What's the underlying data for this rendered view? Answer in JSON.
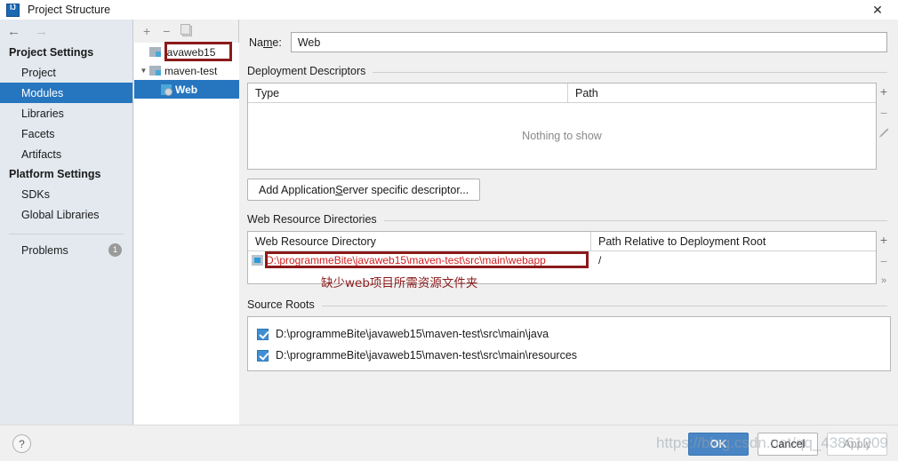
{
  "window": {
    "title": "Project Structure",
    "logo_text": "IJ",
    "close_icon": "✕"
  },
  "nav": {
    "back_icon": "←",
    "forward_icon": "→"
  },
  "sidebar": {
    "groups": [
      {
        "title": "Project Settings",
        "items": [
          {
            "label": "Project",
            "selected": false
          },
          {
            "label": "Modules",
            "selected": true
          },
          {
            "label": "Libraries",
            "selected": false
          },
          {
            "label": "Facets",
            "selected": false
          },
          {
            "label": "Artifacts",
            "selected": false
          }
        ]
      },
      {
        "title": "Platform Settings",
        "items": [
          {
            "label": "SDKs",
            "selected": false
          },
          {
            "label": "Global Libraries",
            "selected": false
          }
        ]
      }
    ],
    "problems": {
      "label": "Problems",
      "count": "1"
    }
  },
  "tree": {
    "toolbar": {
      "add": "+",
      "remove": "−",
      "copy_icon": "copy-icon"
    },
    "nodes": [
      {
        "label": "javaweb15",
        "type": "folder",
        "expandable": false,
        "selected": false
      },
      {
        "label": "maven-test",
        "type": "folder",
        "expandable": true,
        "expanded": true,
        "selected": false
      },
      {
        "label": "Web",
        "type": "module",
        "expandable": false,
        "selected": true,
        "annotated": true
      }
    ]
  },
  "main": {
    "name": {
      "label_pre": "Na",
      "label_mid": "m",
      "label_post": "e:",
      "value": "Web"
    },
    "deployment_descriptors": {
      "title": "Deployment Descriptors",
      "columns": [
        "Type",
        "Path"
      ],
      "rows": [],
      "empty_text": "Nothing to show",
      "buttons": {
        "add": "+",
        "remove": "−",
        "edit": "edit-pencil-icon"
      },
      "add_descriptor_button": {
        "pre": "Add Application ",
        "accel": "S",
        "post": "erver specific descriptor..."
      }
    },
    "web_resource_directories": {
      "title": "Web Resource Directories",
      "columns": [
        "Web Resource Directory",
        "Path Relative to Deployment Root"
      ],
      "rows": [
        {
          "directory": "D:\\programmeBite\\javaweb15\\maven-test\\src\\main\\webapp",
          "relative_path": "/",
          "error": true
        }
      ],
      "annotation": "缺少web项目所需资源文件夹",
      "buttons": {
        "add": "+",
        "remove": "−",
        "more": "»"
      }
    },
    "source_roots": {
      "title": "Source Roots",
      "rows": [
        {
          "path": "D:\\programmeBite\\javaweb15\\maven-test\\src\\main\\java",
          "checked": true
        },
        {
          "path": "D:\\programmeBite\\javaweb15\\maven-test\\src\\main\\resources",
          "checked": true
        }
      ]
    }
  },
  "footer": {
    "help_label": "?",
    "ok_label": "OK",
    "cancel_label": "Cancel",
    "apply_label": "Apply"
  },
  "watermark": {
    "text": "https://blog.csdn.net/qq_43861209"
  },
  "colors": {
    "accent_selection": "#2675bf",
    "annotation_red": "#8b1a1a",
    "error_text": "#d21f1f",
    "primary_button": "#4a86c5",
    "sidebar_bg": "#e3e9ef"
  }
}
